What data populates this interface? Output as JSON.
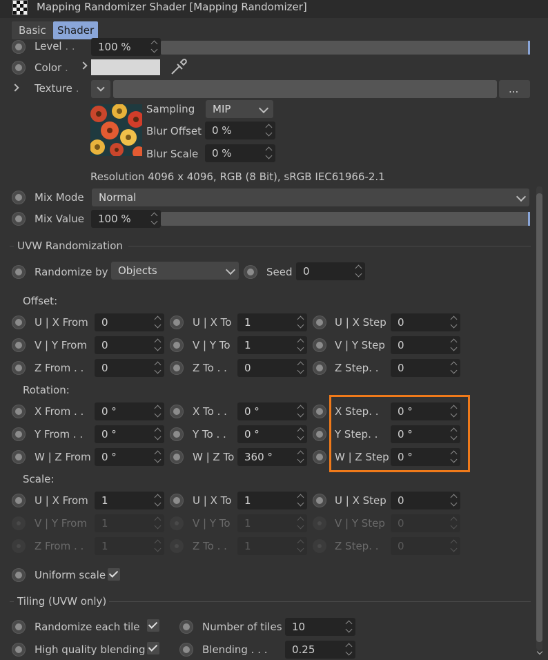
{
  "window": {
    "title": "Mapping Randomizer Shader [Mapping Randomizer]"
  },
  "tabs": [
    {
      "label": "Basic",
      "active": false
    },
    {
      "label": "Shader",
      "active": true
    }
  ],
  "level": {
    "label": "Level",
    "value": "100 %"
  },
  "color": {
    "label": "Color",
    "swatch": "#d8d8d8"
  },
  "texture": {
    "label": "Texture",
    "more_label": "...",
    "sampling_label": "Sampling",
    "sampling_value": "MIP",
    "blur_offset_label": "Blur Offset",
    "blur_offset_value": "0 %",
    "blur_scale_label": "Blur Scale",
    "blur_scale_value": "0 %",
    "resolution": "Resolution 4096 x 4096, RGB (8 Bit), sRGB IEC61966-2.1"
  },
  "mix_mode": {
    "label": "Mix Mode",
    "value": "Normal"
  },
  "mix_value": {
    "label": "Mix Value",
    "value": "100 %"
  },
  "uvw": {
    "title": "UVW Randomization",
    "randomize_by_label": "Randomize by",
    "randomize_by_value": "Objects",
    "seed_label": "Seed",
    "seed_value": "0"
  },
  "offset": {
    "title": "Offset:",
    "rows": [
      [
        {
          "label": "U | X From",
          "value": "0"
        },
        {
          "label": "U | X To",
          "value": "1"
        },
        {
          "label": "U | X Step",
          "value": "0"
        }
      ],
      [
        {
          "label": "V | Y From",
          "value": "0"
        },
        {
          "label": "V | Y To",
          "value": "1"
        },
        {
          "label": "V | Y Step",
          "value": "0"
        }
      ],
      [
        {
          "label": "Z From . .",
          "value": "0"
        },
        {
          "label": "Z To . .",
          "value": "0"
        },
        {
          "label": "Z Step. .",
          "value": "0"
        }
      ]
    ]
  },
  "rotation": {
    "title": "Rotation:",
    "rows": [
      [
        {
          "label": "X From . .",
          "value": "0 °"
        },
        {
          "label": "X To . .",
          "value": "0 °"
        },
        {
          "label": "X Step. .",
          "value": "0 °"
        }
      ],
      [
        {
          "label": "Y From . .",
          "value": "0 °"
        },
        {
          "label": "Y To . .",
          "value": "0 °"
        },
        {
          "label": "Y Step. .",
          "value": "0 °"
        }
      ],
      [
        {
          "label": "W | Z From",
          "value": "0 °"
        },
        {
          "label": "W | Z To",
          "value": "360 °"
        },
        {
          "label": "W | Z Step",
          "value": "0 °"
        }
      ]
    ]
  },
  "scale": {
    "title": "Scale:",
    "rows": [
      [
        {
          "label": "U | X From",
          "value": "1"
        },
        {
          "label": "U | X To",
          "value": "1"
        },
        {
          "label": "U | X Step",
          "value": "0"
        }
      ],
      [
        {
          "label": "V | Y From",
          "value": "1"
        },
        {
          "label": "V | Y To",
          "value": "1"
        },
        {
          "label": "V | Y Step",
          "value": "0"
        }
      ],
      [
        {
          "label": "Z From . .",
          "value": "1"
        },
        {
          "label": "Z To . .",
          "value": "1"
        },
        {
          "label": "Z Step. .",
          "value": "0"
        }
      ]
    ],
    "uniform_label": "Uniform scale",
    "uniform_checked": true
  },
  "tiling": {
    "title": "Tiling (UVW only)",
    "randomize_each_label": "Randomize each tile",
    "randomize_each_checked": true,
    "num_tiles_label": "Number of tiles",
    "num_tiles_value": "10",
    "hq_blend_label": "High quality blending",
    "hq_blend_checked": true,
    "blending_label": "Blending . . .",
    "blending_value": "0.25"
  },
  "colors": {
    "highlight": "#f07a1a",
    "accent": "#8aa6d9"
  }
}
